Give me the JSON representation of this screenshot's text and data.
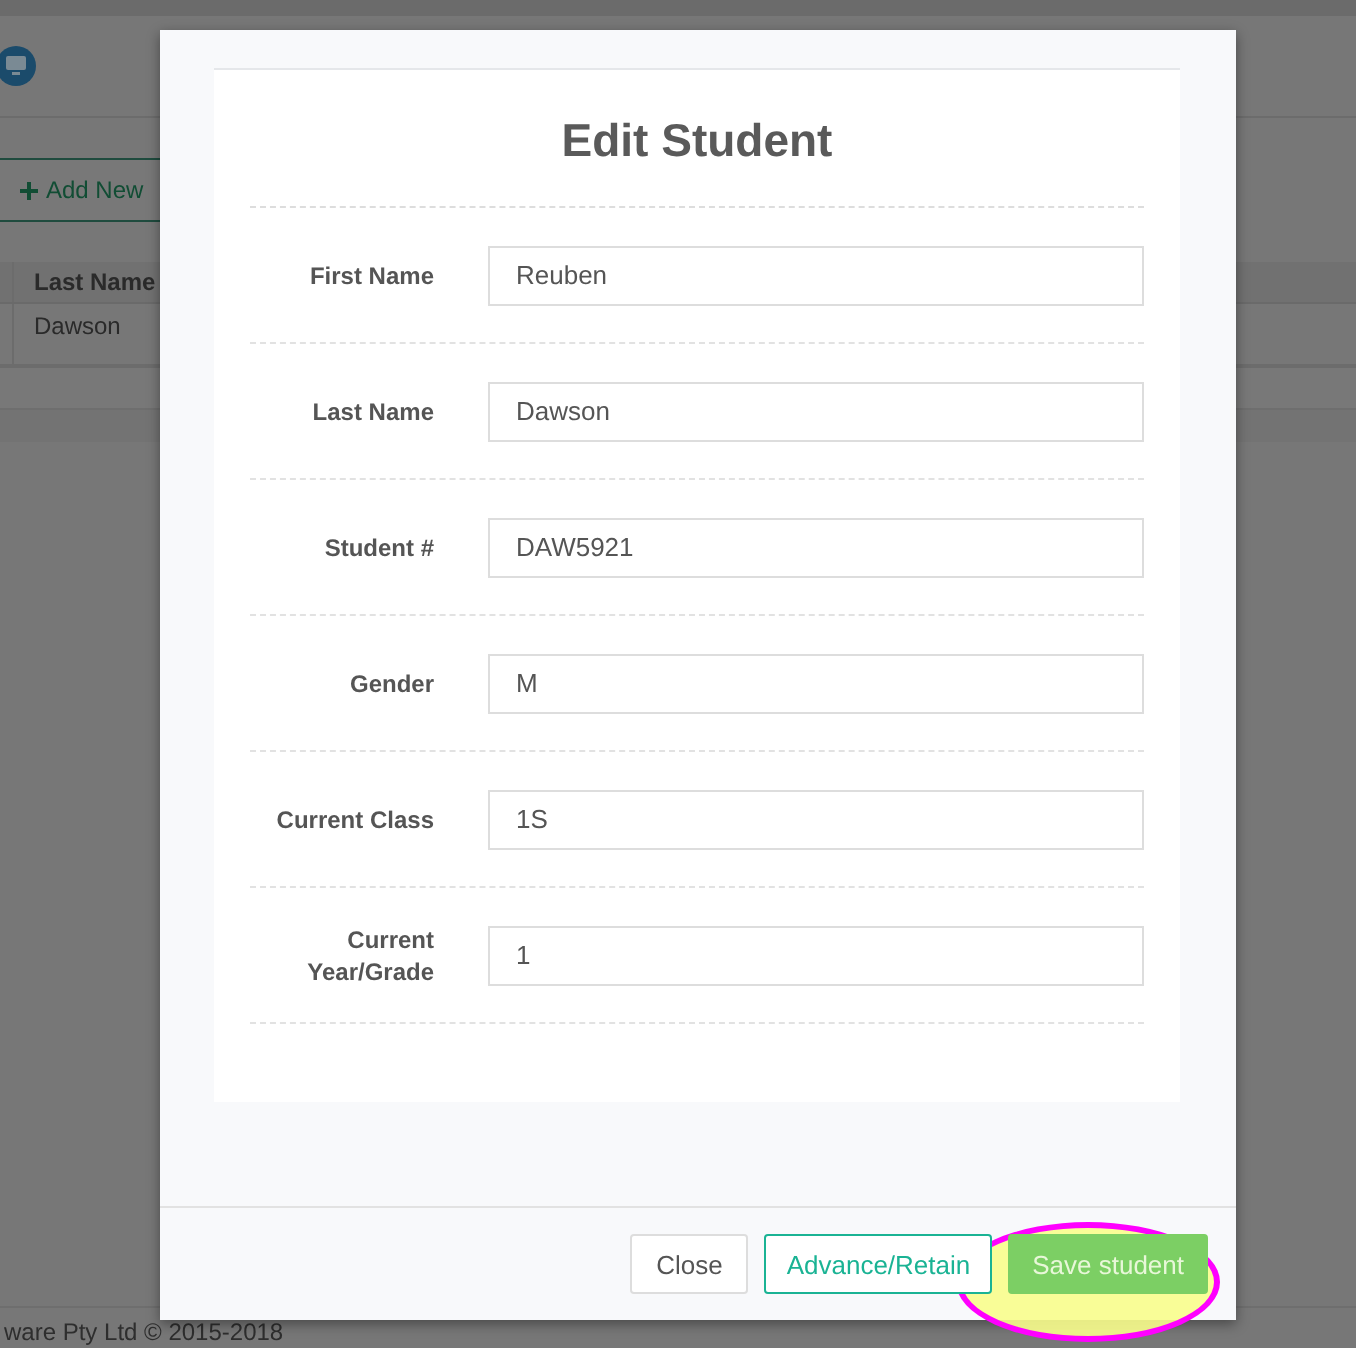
{
  "background": {
    "add_button": "Add New",
    "table": {
      "columns": [
        "Last Name"
      ],
      "rows": [
        [
          "Dawson"
        ]
      ]
    },
    "footer": "ware Pty Ltd © 2015-2018"
  },
  "dialog": {
    "title": "Edit Student",
    "fields": [
      {
        "label": "First Name",
        "value": "Reuben"
      },
      {
        "label": "Last Name",
        "value": "Dawson"
      },
      {
        "label": "Student #",
        "value": "DAW5921"
      },
      {
        "label": "Gender",
        "value": "M"
      },
      {
        "label": "Current Class",
        "value": "1S"
      },
      {
        "label": "Current Year/Grade",
        "value": "1"
      }
    ],
    "buttons": [
      {
        "label": "Close",
        "kind": "default",
        "highlighted": false
      },
      {
        "label": "Advance/Retain",
        "kind": "outline",
        "highlighted": false
      },
      {
        "label": "Save student",
        "kind": "primary",
        "highlighted": true
      }
    ]
  }
}
